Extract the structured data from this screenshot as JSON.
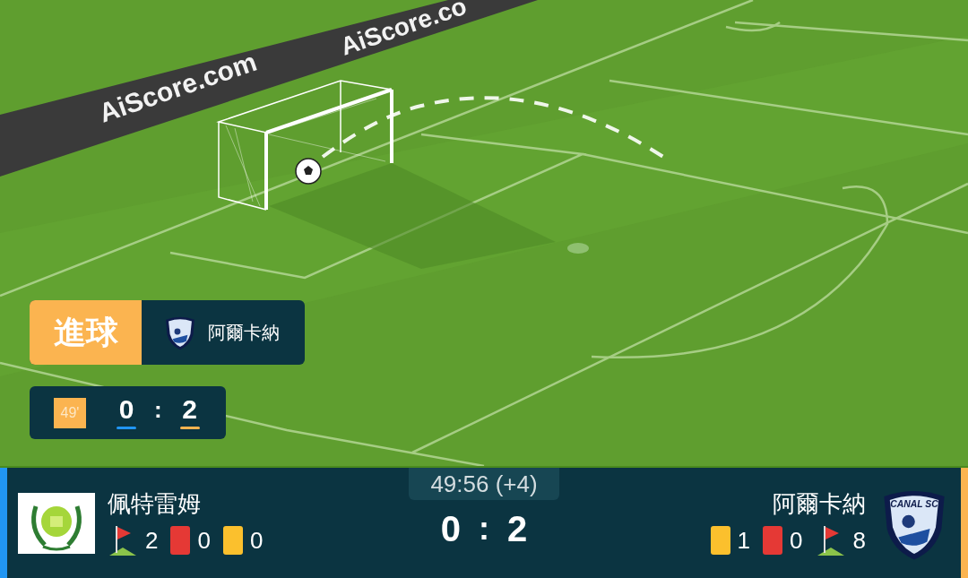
{
  "pitch": {
    "boards": [
      "AiScore.com",
      "AiScore.co"
    ]
  },
  "event": {
    "label": "進球",
    "team": "阿爾卡納"
  },
  "mini_score": {
    "minute": "49'",
    "home": "0",
    "separator": ":",
    "away": "2"
  },
  "scoreboard": {
    "time": "49:56 (+4)",
    "score_home": "0",
    "separator": ":",
    "score_away": "2",
    "home": {
      "name": "佩特雷姆",
      "color": "#2196f3",
      "stats": [
        {
          "kind": "corner",
          "value": "2"
        },
        {
          "kind": "red",
          "value": "0"
        },
        {
          "kind": "yellow",
          "value": "0"
        }
      ]
    },
    "away": {
      "name": "阿爾卡納",
      "color": "#fbb450",
      "logo_text": "CANAL SC",
      "stats": [
        {
          "kind": "yellow",
          "value": "1"
        },
        {
          "kind": "red",
          "value": "0"
        },
        {
          "kind": "corner",
          "value": "8"
        }
      ]
    }
  }
}
